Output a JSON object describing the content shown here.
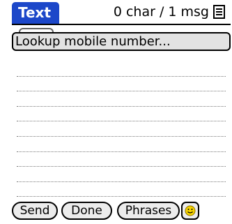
{
  "header": {
    "title": "Text",
    "char_count": "0 char / 1 msg",
    "menu_icon": "menu-list-icon"
  },
  "lookup": {
    "label": "Lookup mobile number..."
  },
  "message": {
    "value": "",
    "line_count": 9
  },
  "buttons": {
    "send": "Send",
    "done": "Done",
    "phrases": "Phrases",
    "emoticon_icon": "smiley-icon"
  },
  "colors": {
    "title_tab": "#1c47c9",
    "smiley_yellow": "#f5d200"
  }
}
